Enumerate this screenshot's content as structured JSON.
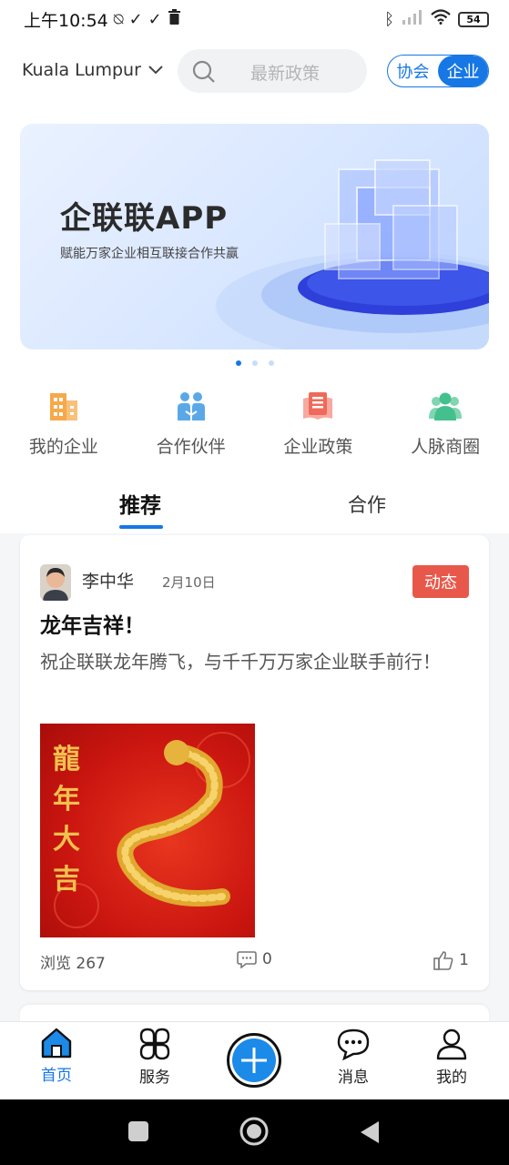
{
  "status_bar": {
    "time": "上午10:54",
    "battery": "54"
  },
  "header": {
    "city": "Kuala Lumpur",
    "search_placeholder": "最新政策",
    "toggle": [
      "协会",
      "企业"
    ],
    "toggle_active": 1
  },
  "banner": {
    "title": "企联联APP",
    "subtitle": "赋能万家企业相互联接合作共赢",
    "dots": 3,
    "active_dot": 0
  },
  "quick_nav": [
    {
      "label": "我的企业",
      "icon": "building-icon",
      "color": "#f6a94a"
    },
    {
      "label": "合作伙伴",
      "icon": "partners-icon",
      "color": "#5aa8e8"
    },
    {
      "label": "企业政策",
      "icon": "policy-book-icon",
      "color": "#ef6a5a"
    },
    {
      "label": "人脉商圈",
      "icon": "network-people-icon",
      "color": "#43c08e"
    }
  ],
  "tabs": [
    {
      "label": "推荐",
      "active": true
    },
    {
      "label": "合作",
      "active": false
    }
  ],
  "post": {
    "author": "李中华",
    "date": "2月10日",
    "tag": "动态",
    "title": "龙年吉祥！",
    "body": "祝企联联龙年腾飞，与千千万万家企业联手前行！",
    "image_text": "龍年大吉",
    "views_label": "浏览 267",
    "comments": "0",
    "likes": "1"
  },
  "bottom_nav": [
    {
      "label": "首页",
      "icon": "home-icon",
      "active": true
    },
    {
      "label": "服务",
      "icon": "services-icon",
      "active": false
    },
    {
      "label": "",
      "icon": "add-icon",
      "active": false
    },
    {
      "label": "消息",
      "icon": "message-icon",
      "active": false
    },
    {
      "label": "我的",
      "icon": "profile-icon",
      "active": false
    }
  ],
  "colors": {
    "accent": "#1677e5",
    "tag": "#e8584a",
    "fab": "#1c8ae8"
  }
}
